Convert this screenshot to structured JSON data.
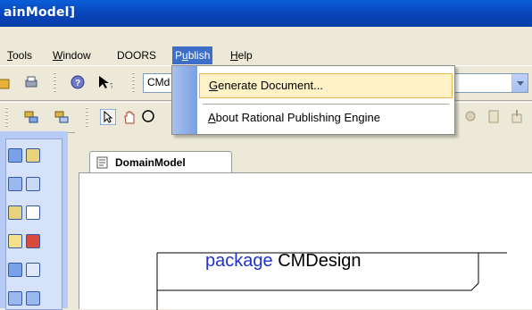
{
  "window": {
    "title": "ainModel]"
  },
  "menubar": {
    "items": [
      {
        "label": "Tools",
        "key": "T",
        "rest": "ools"
      },
      {
        "label": "Window",
        "key": "W",
        "rest": "indow"
      },
      {
        "label": "DOORS"
      },
      {
        "label": "Publish",
        "key": "u",
        "pre": "P",
        "rest": "blish"
      },
      {
        "label": "Help",
        "key": "H",
        "rest": "elp"
      }
    ]
  },
  "toolbar": {
    "combo_value": "CMd"
  },
  "publish_menu": {
    "items": [
      {
        "label": "Generate Document...",
        "key": "G",
        "rest": "enerate Document..."
      },
      {
        "label": "About Rational Publishing Engine",
        "key": "A",
        "rest": "bout Rational Publishing Engine"
      }
    ]
  },
  "document_tab": {
    "label": "DomainModel"
  },
  "diagram": {
    "package_keyword": "package",
    "package_name": "CMDesign"
  },
  "colors": {
    "titlebar": "#0842b8",
    "menu_highlight": "#3d6fc8",
    "item_hover": "#fff2c7",
    "keyword": "#1f33c8"
  }
}
